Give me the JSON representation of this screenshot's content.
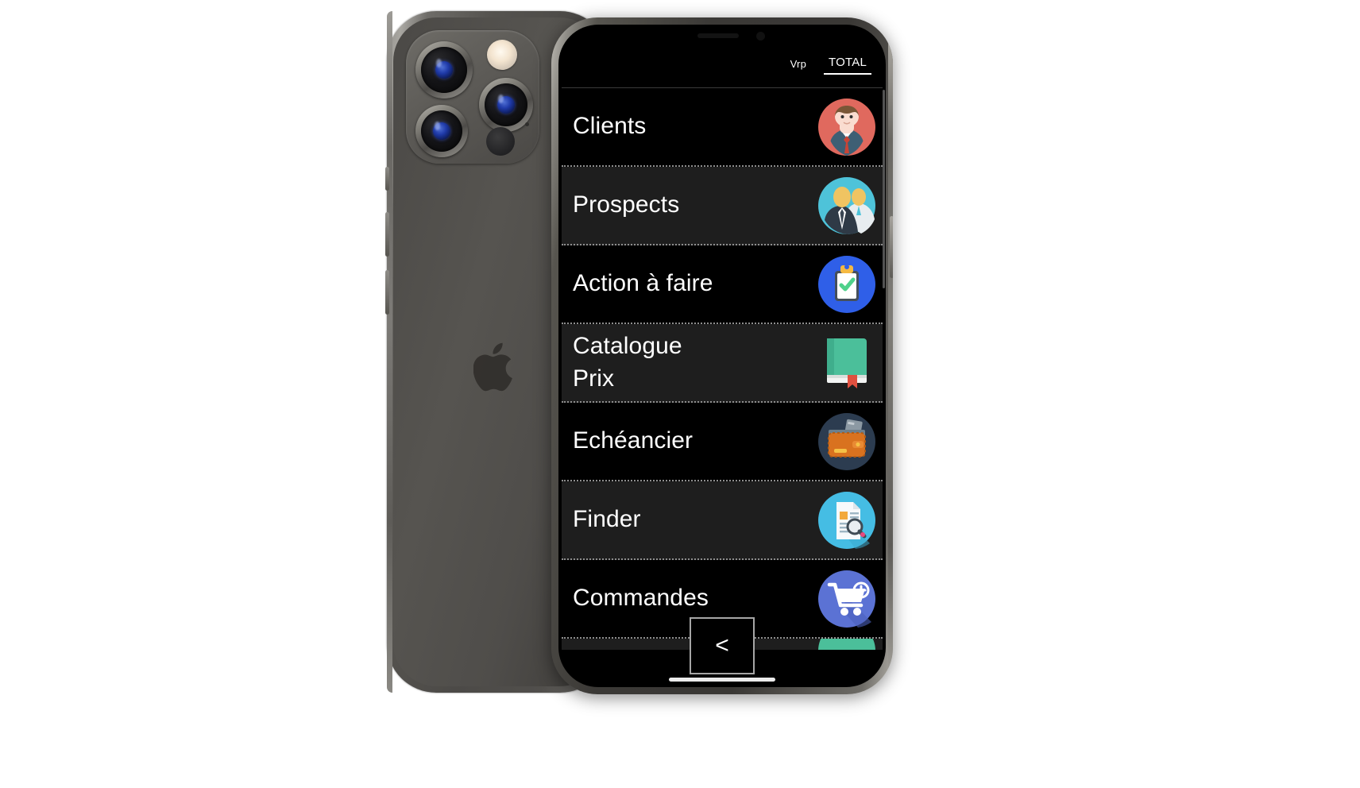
{
  "device": {
    "model_name": "iPhone 12 Pro",
    "body_color": "#4c4a47",
    "rail_color": "#8d8b86"
  },
  "app": {
    "screen_background": "#000000",
    "accent_text_color": "#ffffff",
    "header": {
      "tabs": [
        {
          "label": "Vrp",
          "active": false,
          "name": "tab-vrp"
        },
        {
          "label": "TOTAL",
          "active": true,
          "name": "tab-total"
        }
      ]
    },
    "menu": {
      "items": [
        {
          "label": "Clients",
          "icon": "businessman-avatar-icon",
          "icon_color": "#e0695e",
          "row_shade": "dark"
        },
        {
          "label": "Prospects",
          "icon": "two-businessmen-icon",
          "icon_color": "#4ec3d9",
          "row_shade": "light"
        },
        {
          "label": "Action à faire",
          "icon": "clipboard-check-icon",
          "icon_color": "#2f5fe8",
          "row_shade": "dark"
        },
        {
          "label": "Catalogue\nPrix",
          "icon": "green-book-icon",
          "icon_color": "#4bbf9a",
          "row_shade": "light"
        },
        {
          "label": "Echéancier",
          "icon": "wallet-card-icon",
          "icon_color": "#2c3c50",
          "row_shade": "dark"
        },
        {
          "label": "Finder",
          "icon": "document-search-icon",
          "icon_color": "#45bde4",
          "row_shade": "light"
        },
        {
          "label": "Commandes",
          "icon": "cart-plus-icon",
          "icon_color": "#5b72d4",
          "row_shade": "dark"
        }
      ],
      "partial_next_item": {
        "icon": "teal-circle-icon",
        "icon_color": "#4bbf9a"
      }
    },
    "footer": {
      "back_button_label": "<",
      "back_button_name": "back-button"
    }
  }
}
